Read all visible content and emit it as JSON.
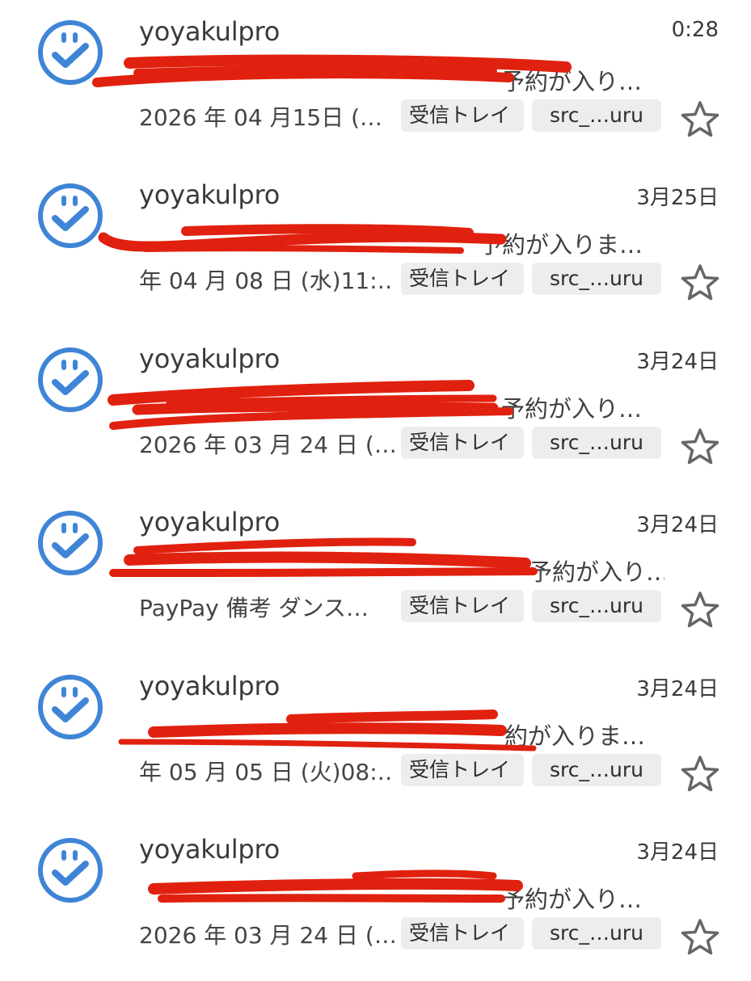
{
  "colors": {
    "avatar_blue": "#3f85d6",
    "redaction_red": "#e0210f",
    "chip_background": "#ededed"
  },
  "icons": {
    "avatar": "smiley-check-icon",
    "star": "star-outline-icon"
  },
  "emails": [
    {
      "sender": "yoyakulpro",
      "date": "0:28",
      "subject_visible": "予約が入り…",
      "preview": "2026 年 04 月15日 (…",
      "labels": [
        "受信トレイ",
        "src_…uru"
      ],
      "starred": false
    },
    {
      "sender": "yoyakulpro",
      "date": "3月25日",
      "subject_visible": "予約が入りま…",
      "preview": "年 04 月 08 日 (水)11:…",
      "labels": [
        "受信トレイ",
        "src_…uru"
      ],
      "starred": false
    },
    {
      "sender": "yoyakulpro",
      "date": "3月24日",
      "subject_visible": "予約が入り…",
      "preview": "2026 年 03 月 24 日 (…",
      "labels": [
        "受信トレイ",
        "src_…uru"
      ],
      "starred": false
    },
    {
      "sender": "yoyakulpro",
      "date": "3月24日",
      "subject_visible": "予約が入り…",
      "preview": "PayPay 備考 ダンス…",
      "labels": [
        "受信トレイ",
        "src_…uru"
      ],
      "starred": false
    },
    {
      "sender": "yoyakulpro",
      "date": "3月24日",
      "subject_visible": "約が入りま…",
      "preview": "年 05 月 05 日 (火)08:…",
      "labels": [
        "受信トレイ",
        "src_…uru"
      ],
      "starred": false
    },
    {
      "sender": "yoyakulpro",
      "date": "3月24日",
      "subject_visible": "予約が入り…",
      "preview": "2026 年 03 月 24 日 (…",
      "labels": [
        "受信トレイ",
        "src_…uru"
      ],
      "starred": false
    }
  ]
}
